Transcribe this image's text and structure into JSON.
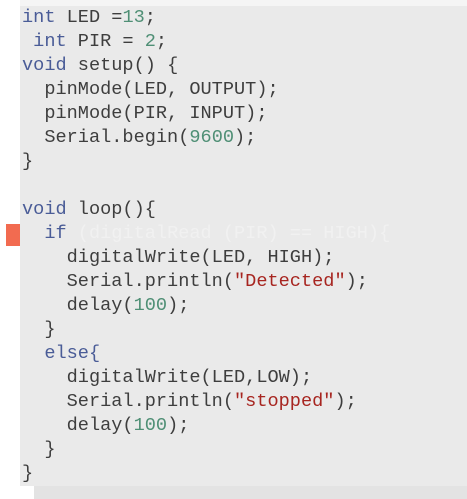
{
  "editor": {
    "error_marker_color": "#f26b50",
    "lines": [
      [
        {
          "t": "int",
          "c": "kw"
        },
        {
          "t": " LED =",
          "c": "plain"
        },
        {
          "t": "13",
          "c": "num"
        },
        {
          "t": ";",
          "c": "plain"
        }
      ],
      [
        {
          "t": " int",
          "c": "kw"
        },
        {
          "t": " PIR = ",
          "c": "plain"
        },
        {
          "t": "2",
          "c": "num"
        },
        {
          "t": ";",
          "c": "plain"
        }
      ],
      [
        {
          "t": "void",
          "c": "kw"
        },
        {
          "t": " setup() {",
          "c": "plain"
        }
      ],
      [
        {
          "t": "  pinMode(LED, OUTPUT);",
          "c": "plain"
        }
      ],
      [
        {
          "t": "  pinMode(PIR, INPUT);",
          "c": "plain"
        }
      ],
      [
        {
          "t": "  Serial.begin(",
          "c": "plain"
        },
        {
          "t": "9600",
          "c": "num"
        },
        {
          "t": ");",
          "c": "plain"
        }
      ],
      [
        {
          "t": "}",
          "c": "plain"
        }
      ],
      [],
      [
        {
          "t": "void",
          "c": "kw"
        },
        {
          "t": " loop(){",
          "c": "plain"
        }
      ],
      [
        {
          "t": "  if",
          "c": "kw"
        },
        {
          "t": " (digitalRead (PIR) == HIGH){",
          "c": "ghost"
        }
      ],
      [
        {
          "t": "    digitalWrite(LED, HIGH);",
          "c": "plain"
        }
      ],
      [
        {
          "t": "    Serial.println(",
          "c": "plain"
        },
        {
          "t": "\"Detected\"",
          "c": "str"
        },
        {
          "t": ");",
          "c": "plain"
        }
      ],
      [
        {
          "t": "    delay(",
          "c": "plain"
        },
        {
          "t": "100",
          "c": "num"
        },
        {
          "t": ");",
          "c": "plain"
        }
      ],
      [
        {
          "t": "  }",
          "c": "plain"
        }
      ],
      [
        {
          "t": "  else{",
          "c": "kw"
        }
      ],
      [
        {
          "t": "    digitalWrite(LED,LOW);",
          "c": "plain"
        }
      ],
      [
        {
          "t": "    Serial.println(",
          "c": "plain"
        },
        {
          "t": "\"stopped\"",
          "c": "str"
        },
        {
          "t": ");",
          "c": "plain"
        }
      ],
      [
        {
          "t": "    delay(",
          "c": "plain"
        },
        {
          "t": "100",
          "c": "num"
        },
        {
          "t": ");",
          "c": "plain"
        }
      ],
      [
        {
          "t": "  }",
          "c": "plain"
        }
      ],
      [
        {
          "t": "}",
          "c": "plain"
        }
      ]
    ]
  }
}
